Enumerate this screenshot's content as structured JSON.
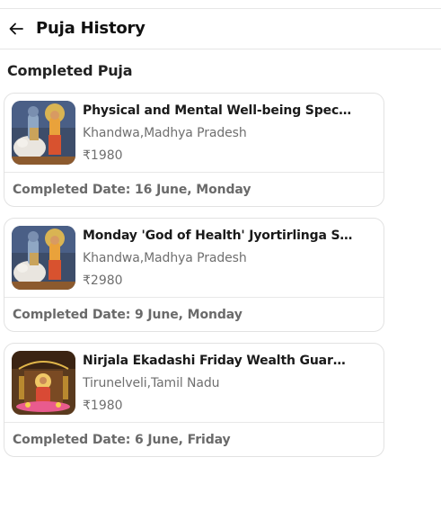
{
  "header": {
    "title": "Puja History",
    "back_icon": "arrow-left-icon"
  },
  "section": {
    "title": "Completed Puja"
  },
  "colors": {
    "text_primary": "#1a1a1a",
    "text_secondary": "#6f6f6f",
    "border": "#e2e2e2"
  },
  "pujas": [
    {
      "title": "Physical and Mental Well-being Special H...",
      "location": "Khandwa,Madhya Pradesh",
      "price": "₹1980",
      "completed": "Completed Date: 16 June, Monday",
      "image": "shiva-parvati-nandi-image"
    },
    {
      "title": "Monday 'God of Health' Jyortirlinga Spec...",
      "location": "Khandwa,Madhya Pradesh",
      "price": "₹2980",
      "completed": "Completed Date: 9 June, Monday",
      "image": "shiva-parvati-nandi-image"
    },
    {
      "title": "Nirjala Ekadashi Friday Wealth Guardian ...",
      "location": "Tirunelveli,Tamil Nadu",
      "price": "₹1980",
      "completed": "Completed Date: 6 June, Friday",
      "image": "lakshmi-temple-image"
    }
  ]
}
